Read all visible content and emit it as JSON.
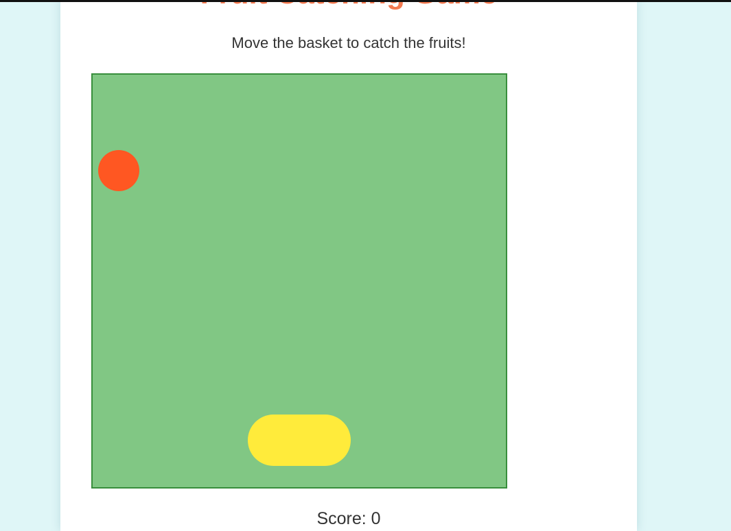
{
  "header": {
    "title": "Fruit Catching Game",
    "instructions": "Move the basket to catch the fruits!"
  },
  "game": {
    "fruit": {
      "color": "#ff5722",
      "icon": "orange-fruit-icon"
    },
    "basket": {
      "color": "#ffeb3b",
      "icon": "basket-icon"
    },
    "field_color": "#81c784",
    "field_border_color": "#388e3c"
  },
  "score": {
    "label": "Score: ",
    "value": "0"
  },
  "colors": {
    "page_background": "#dff6f7",
    "card_background": "#ffffff",
    "title_color": "#f47a50",
    "text_color": "#333333"
  }
}
